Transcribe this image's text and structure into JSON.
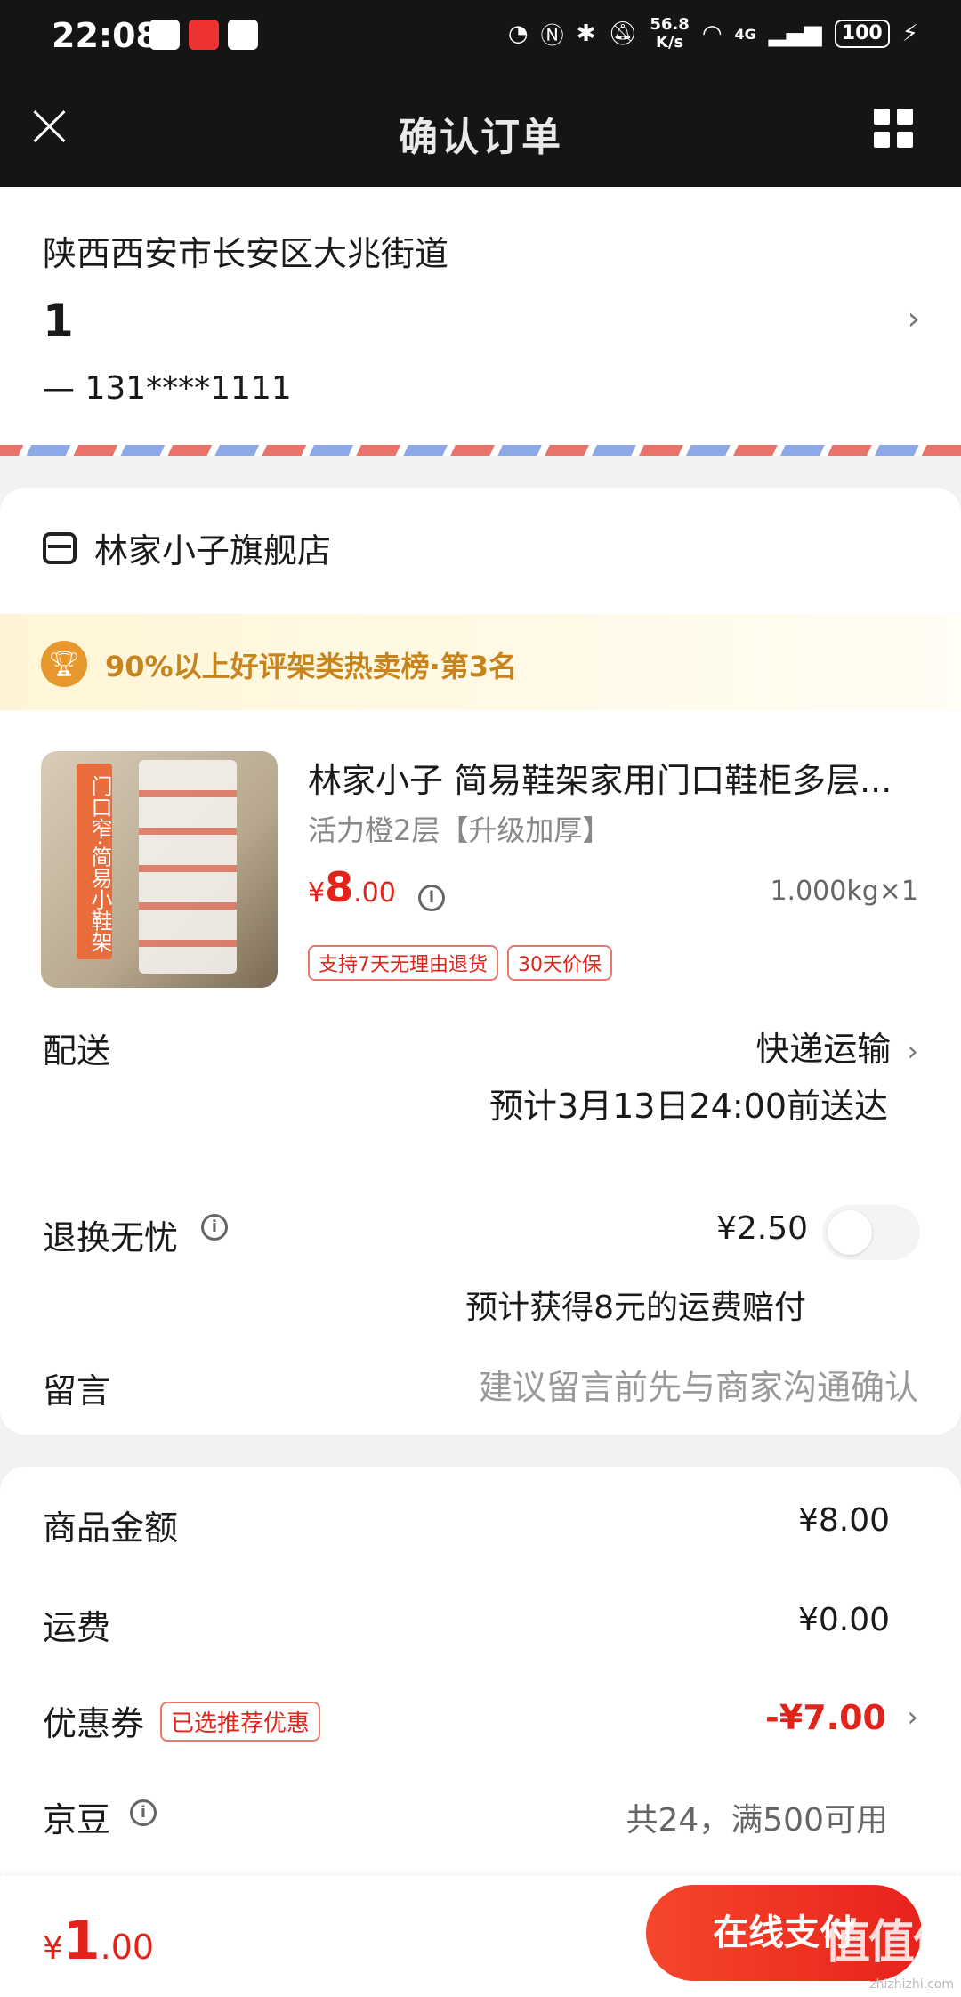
{
  "status_bar": {
    "time": "22:08",
    "speed_value": "56.8",
    "speed_unit": "K/s",
    "network": "4G",
    "battery": "100"
  },
  "nav": {
    "title": "确认订单"
  },
  "address": {
    "line": "陕西西安市长安区大兆街道",
    "name": "1",
    "phone": "— 131****1111"
  },
  "store": {
    "name": "林家小子旗舰店",
    "rank_text": "90%以上好评架类热卖榜·第3名"
  },
  "product": {
    "image_banner": "门口窄·简易小鞋架",
    "title": "林家小子 简易鞋架家用门口鞋柜多层...",
    "spec": "活力橙2层【升级加厚】",
    "price_symbol": "¥",
    "price_int": "8",
    "price_dec": ".00",
    "weight_qty": "1.000kg×1",
    "tags": [
      "支持7天无理由退货",
      "30天价保"
    ]
  },
  "delivery": {
    "label": "配送",
    "method": "快递运输",
    "eta": "预计3月13日24:00前送达"
  },
  "return_service": {
    "label": "退换无忧",
    "price": "¥2.50",
    "note": "预计获得8元的运费赔付",
    "enabled": false
  },
  "message": {
    "label": "留言",
    "placeholder": "建议留言前先与商家沟通确认"
  },
  "fees": {
    "goods_label": "商品金额",
    "goods_value": "¥8.00",
    "shipping_label": "运费",
    "shipping_value": "¥0.00",
    "coupon_label": "优惠券",
    "coupon_tag": "已选推荐优惠",
    "coupon_value": "-¥7.00",
    "jd_label": "京豆",
    "jd_value": "共24，满500可用"
  },
  "bottom": {
    "total_symbol": "¥",
    "total_int": "1",
    "total_dec": ".00",
    "pay_label": "在线支付"
  },
  "watermark": {
    "logo": "值值值",
    "site": "zhizhizhi.com"
  },
  "colors": {
    "accent_red": "#e2231a",
    "rank_gold": "#c7841d",
    "header_bg": "#151515"
  }
}
